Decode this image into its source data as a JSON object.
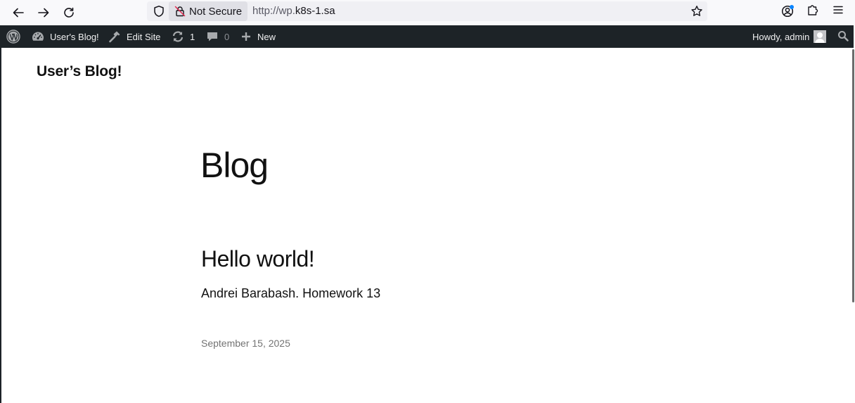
{
  "browser": {
    "security_label": "Not Secure",
    "url_prefix": "http://wp.",
    "url_host": "k8s-1.sa"
  },
  "adminbar": {
    "site_name": "User's Blog!",
    "edit_site": "Edit Site",
    "updates_count": "1",
    "comments_count": "0",
    "new_label": "New",
    "greeting": "Howdy, admin"
  },
  "site": {
    "title": "User’s Blog!"
  },
  "main": {
    "heading": "Blog",
    "post": {
      "title": "Hello world!",
      "excerpt": "Andrei Barabash. Homework 13",
      "date": "September 15, 2025"
    }
  },
  "icons": {
    "back": "arrow-left-icon",
    "forward": "arrow-right-icon",
    "reload": "reload-icon",
    "shield": "shield-icon",
    "insecure_lock": "insecure-lock-icon",
    "bookmark": "star-icon",
    "account": "account-icon",
    "extensions": "puzzle-icon",
    "menu": "hamburger-menu-icon",
    "wordpress": "wordpress-logo-icon",
    "dashboard": "dashboard-icon",
    "edit": "hammer-icon",
    "updates": "updates-icon",
    "comments": "comment-icon",
    "plus": "plus-icon",
    "search": "search-icon"
  },
  "colors": {
    "adminbar_bg": "#1d2327",
    "adminbar_text": "#f0f0f1",
    "text": "#111111",
    "date": "#737373",
    "notification_dot": "#0a84ff"
  }
}
